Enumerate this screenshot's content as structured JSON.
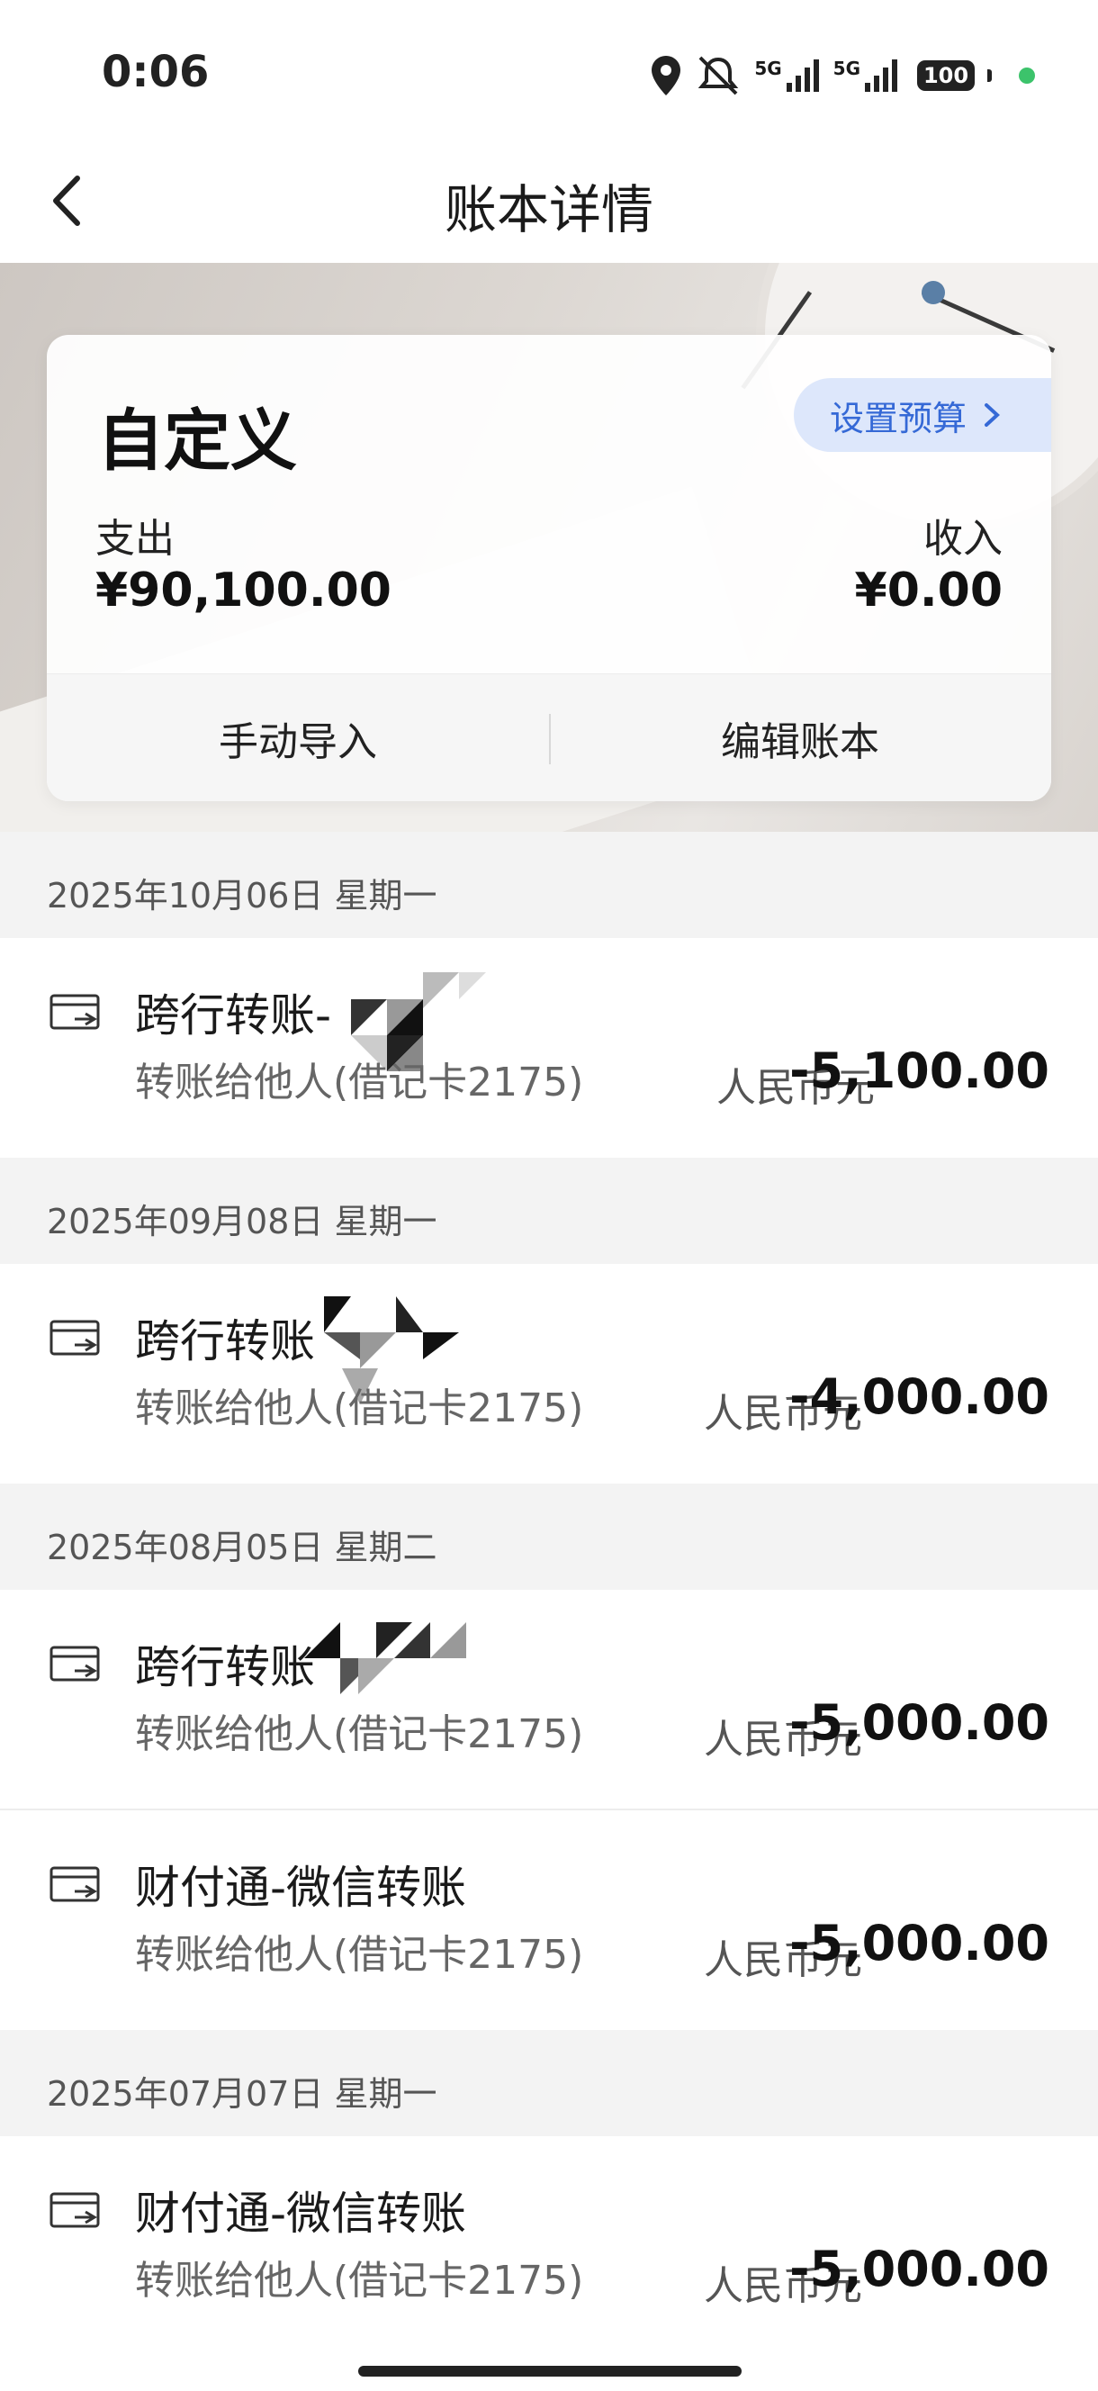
{
  "status_bar": {
    "time": "0:06",
    "battery": "100",
    "net1": "5G",
    "net2": "5G"
  },
  "header": {
    "title": "账本详情"
  },
  "card": {
    "book_name": "自定义",
    "budget_label": "设置预算",
    "expense_label": "支出",
    "expense_value": "¥90,100.00",
    "income_label": "收入",
    "income_value": "¥0.00",
    "manual_import": "手动导入",
    "edit_book": "编辑账本"
  },
  "groups": [
    {
      "date": "2025年10月06日 星期一",
      "items": [
        {
          "title": "跨行转账-",
          "subtitle": "转账给他人(借记卡2175)",
          "currency": "人民币元",
          "amount": "-5,100.00"
        }
      ]
    },
    {
      "date": "2025年09月08日 星期一",
      "items": [
        {
          "title": "跨行转账",
          "subtitle": "转账给他人(借记卡2175)",
          "currency": "人民币元",
          "amount": "-4,000.00"
        }
      ]
    },
    {
      "date": "2025年08月05日 星期二",
      "items": [
        {
          "title": "跨行转账",
          "subtitle": "转账给他人(借记卡2175)",
          "currency": "人民币元",
          "amount": "-5,000.00"
        },
        {
          "title": "财付通-微信转账",
          "subtitle": "转账给他人(借记卡2175)",
          "currency": "人民币元",
          "amount": "-5,000.00"
        }
      ]
    },
    {
      "date": "2025年07月07日 星期一",
      "items": [
        {
          "title": "财付通-微信转账",
          "subtitle": "转账给他人(借记卡2175)",
          "currency": "人民币元",
          "amount": "-5,000.00"
        }
      ]
    }
  ]
}
